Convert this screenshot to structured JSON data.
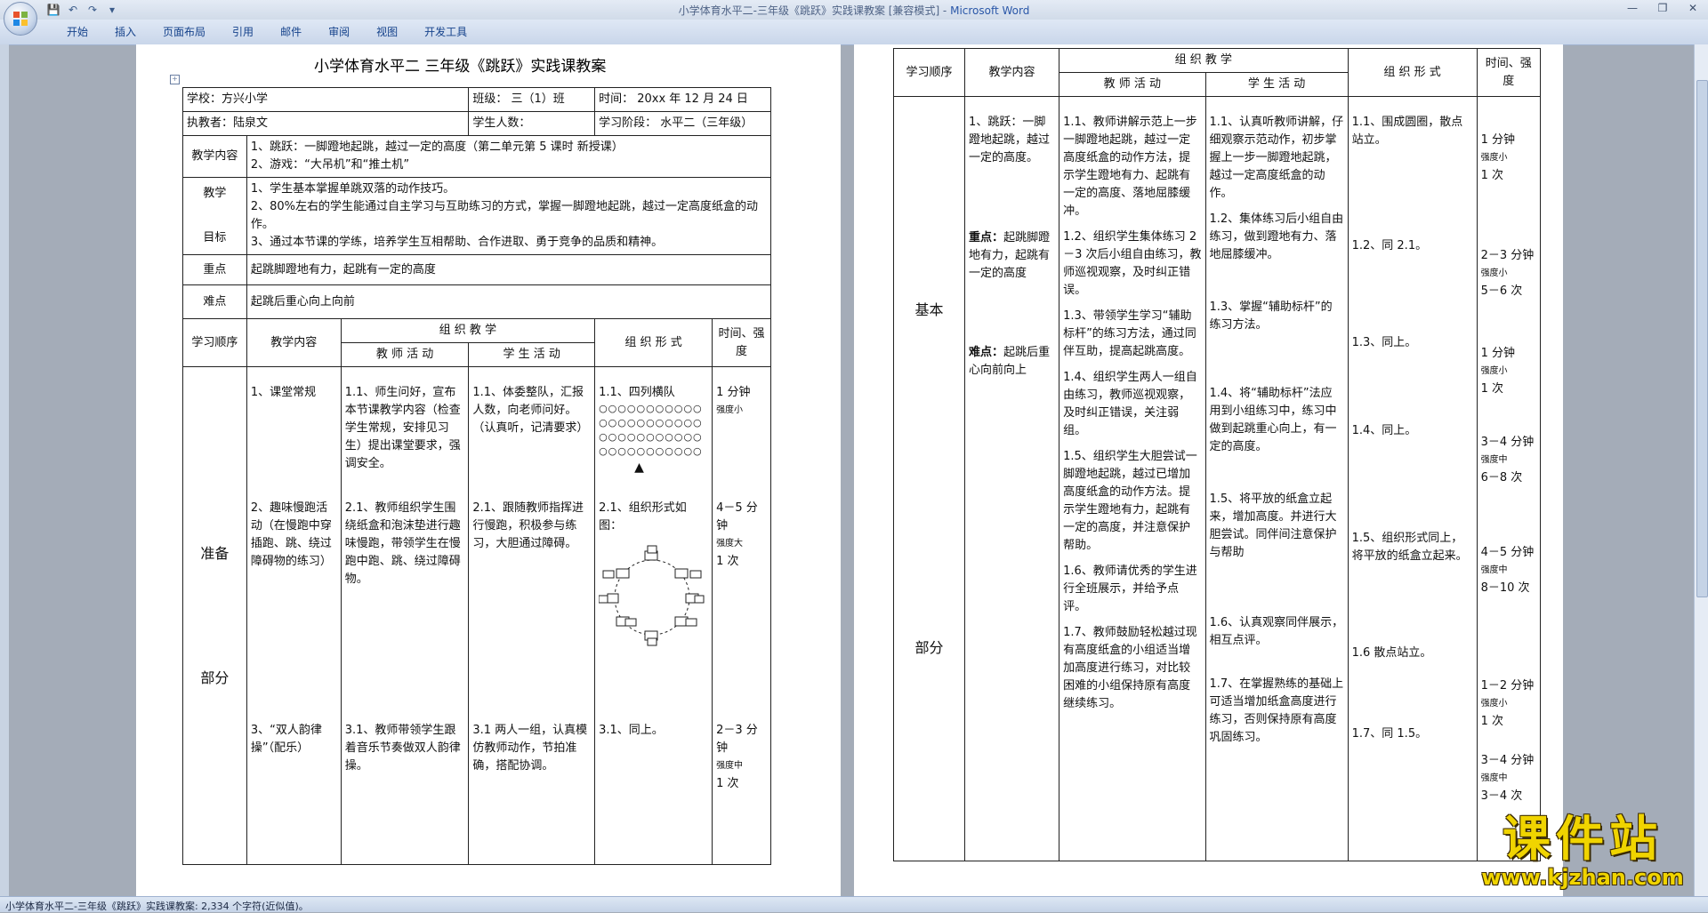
{
  "window": {
    "title_prefix": "小学体育水平二-三年级《跳跃》实践课教案 [兼容模式] - ",
    "title_product": "Microsoft Word"
  },
  "ribbon": {
    "tabs": [
      "开始",
      "插入",
      "页面布局",
      "引用",
      "邮件",
      "审阅",
      "视图",
      "开发工具"
    ]
  },
  "doc": {
    "title": "小学体育水平二   三年级《跳跃》实践课教案",
    "school": "学校：方兴小学",
    "class": "班级：  三（1）班",
    "time": "时间：  20xx 年 12 月 24 日",
    "teacher": "执教者：陆泉文",
    "students": "学生人数：",
    "stage": "学习阶段：  水平二（三年级）",
    "content_label": "教学内容",
    "content_1": "1、跳跃：一脚蹬地起跳，越过一定的高度（第二单元第 5 课时 新授课）",
    "content_2": "2、游戏：“大吊机”和“推土机”",
    "goal_label_1": "教学",
    "goal_label_2": "目标",
    "goal_1": "1、学生基本掌握单跳双落的动作技巧。",
    "goal_2": "2、80%左右的学生能通过自主学习与互助练习的方式，掌握一脚蹬地起跳，越过一定高度纸盒的动作。",
    "goal_3": "3、通过本节课的学练，培养学生互相帮助、合作进取、勇于竞争的品质和精神。",
    "key_label": "重点",
    "key_text": "起跳脚蹬地有力，起跳有一定的高度",
    "diff_label": "难点",
    "diff_text": "起跳后重心向上向前",
    "h_order": "学习顺序",
    "h_content": "教学内容",
    "h_org": "组  织  教  学",
    "h_teacher": "教 师 活 动",
    "h_student": "学 生 活 动",
    "h_form": "组 织 形 式",
    "h_time": "时间、强度",
    "prep_1": "准备",
    "prep_2": "部分",
    "p1_content": "1、课堂常规",
    "p1_teacher": "1.1、师生问好，宣布本节课教学内容（检查学生常规，安排见习生）提出课堂要求，强调安全。",
    "p1_student": "1.1、体委整队，汇报人数，向老师问好。（认真听，记清要求）",
    "p1_form": "1.1、四列横队",
    "p1_form_rows": [
      "○○○○○○○○○○○",
      "○○○○○○○○○○○",
      "○○○○○○○○○○○",
      "○○○○○○○○○○○"
    ],
    "p1_form_mark": "▲",
    "p1_time_a": "1 分钟",
    "p1_time_b": "强度小",
    "p2_content": "2、趣味慢跑活动（在慢跑中穿插跑、跳、绕过障碍物的练习）",
    "p2_teacher": "2.1、教师组织学生围绕纸盒和泡沫垫进行趣味慢跑，带领学生在慢跑中跑、跳、绕过障碍物。",
    "p2_student": "2.1、跟随教师指挥进行慢跑，积极参与练习，大胆通过障碍。",
    "p2_form": "2.1、组织形式如图：",
    "p2_time_a": "4－5 分钟",
    "p2_time_b": "强度大",
    "p2_time_c": "1 次",
    "p3_content": "3、“双人韵律操”（配乐）",
    "p3_teacher": "3.1、教师带领学生跟着音乐节奏做双人韵律操。",
    "p3_student": "3.1 两人一组，认真模仿教师动作，节拍准确，搭配协调。",
    "p3_form": "3.1、同上。",
    "p3_time_a": "2－3 分钟",
    "p3_time_b": "强度中",
    "p3_time_c": "1 次",
    "basic_1": "基本",
    "basic_2": "部分",
    "b_content_1": "1、跳跃：一脚蹬地起跳，越过一定的高度。",
    "b_key_label": "重点：",
    "b_key_text": "起跳脚蹬地有力，起跳有一定的高度",
    "b_diff_label": "难点：",
    "b_diff_text": "起跳后重心向前向上",
    "rows": [
      {
        "teacher": "1.1、教师讲解示范上一步一脚蹬地起跳，越过一定高度纸盒的动作方法，提示学生蹬地有力、起跳有一定的高度、落地屈膝缓冲。",
        "student": "1.1、认真听教师讲解，仔细观察示范动作，初步掌握上一步一脚蹬地起跳，越过一定高度纸盒的动作。",
        "form": "1.1、围成圆圈，散点站立。",
        "time_a": "1 分钟",
        "time_b": "强度小",
        "time_c": "1 次"
      },
      {
        "teacher": "1.2、组织学生集体练习 2－3 次后小组自由练习，教师巡视观察，及时纠正错误。",
        "student": "1.2、集体练习后小组自由练习，做到蹬地有力、落地屈膝缓冲。",
        "form": "1.2、同 2.1。",
        "time_a": "2－3 分钟",
        "time_b": "强度小",
        "time_c": "5－6 次"
      },
      {
        "teacher": "1.3、带领学生学习“辅助标杆”的练习方法，通过同伴互助，提高起跳高度。",
        "student": "1.3、掌握“辅助标杆”的练习方法。",
        "form": "1.3、同上。",
        "time_a": "1 分钟",
        "time_b": "强度小",
        "time_c": "1 次"
      },
      {
        "teacher": "1.4、组织学生两人一组自由练习，教师巡视观察，及时纠正错误，关注弱组。",
        "student": "1.4、将“辅助标杆”法应用到小组练习中，练习中做到起跳重心向上，有一定的高度。",
        "form": "1.4、同上。",
        "time_a": "3－4 分钟",
        "time_b": "强度中",
        "time_c": "6－8 次"
      },
      {
        "teacher": "1.5、组织学生大胆尝试一脚蹬地起跳，越过已增加高度纸盒的动作方法。提示学生蹬地有力，起跳有一定的高度，并注意保护帮助。",
        "student": "1.5、将平放的纸盒立起来，增加高度。并进行大胆尝试。同伴间注意保护与帮助",
        "form": "1.5、组织形式同上，将平放的纸盒立起来。",
        "time_a": "4－5 分钟",
        "time_b": "强度中",
        "time_c": "8－10 次"
      },
      {
        "teacher": "1.6、教师请优秀的学生进行全班展示，并给予点评。",
        "student": "1.6、认真观察同伴展示，相互点评。",
        "form": "1.6 散点站立。",
        "time_a": "1－2 分钟",
        "time_b": "强度小",
        "time_c": "1 次"
      },
      {
        "teacher": "1.7、教师鼓励轻松越过现有高度纸盒的小组适当增加高度进行练习，对比较困难的小组保持原有高度继续练习。",
        "student": "1.7、在掌握熟练的基础上可适当增加纸盒高度进行练习，否则保持原有高度巩固练习。",
        "form": "1.7、同 1.5。",
        "time_a": "3－4 分钟",
        "time_b": "强度中",
        "time_c": "3－4 次"
      }
    ]
  },
  "status": {
    "text": "小学体育水平二-三年级《跳跃》实践课教案: 2,334 个字符(近似值)。"
  },
  "watermark": {
    "big": "课件站",
    "url": "www.kjzhan.com"
  }
}
